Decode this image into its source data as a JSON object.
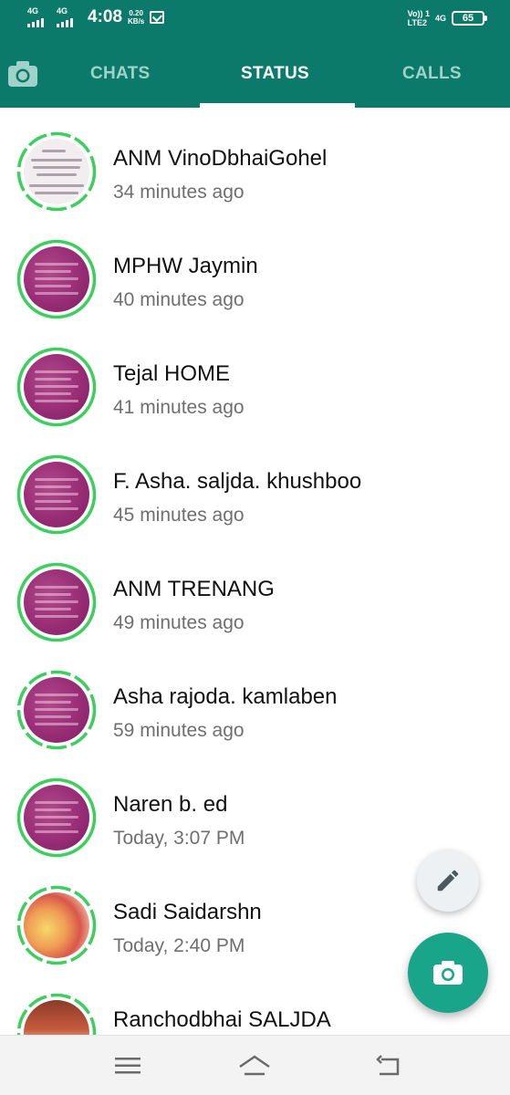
{
  "statusbar": {
    "sim1": "4G",
    "sim2": "4G",
    "time": "4:08",
    "speed_value": "0.20",
    "speed_unit": "KB/s",
    "volte_top": "Vo)) 1",
    "volte_bottom": "LTE2",
    "network": "4G",
    "battery": "65"
  },
  "tabs": {
    "chats": "CHATS",
    "status": "STATUS",
    "calls": "CALLS",
    "active": "STATUS"
  },
  "statuses": [
    {
      "name": "ANM VinoDbhaiGohel",
      "time": "34 minutes ago",
      "thumb": "document",
      "ring": "partial"
    },
    {
      "name": "MPHW Jaymin",
      "time": "40 minutes ago",
      "thumb": "purple",
      "ring": "full"
    },
    {
      "name": "Tejal HOME",
      "time": "41 minutes ago",
      "thumb": "purple",
      "ring": "full"
    },
    {
      "name": "F. Asha. saljda. khushboo",
      "time": "45 minutes ago",
      "thumb": "purple",
      "ring": "full"
    },
    {
      "name": "ANM TRENANG",
      "time": "49 minutes ago",
      "thumb": "purple",
      "ring": "full"
    },
    {
      "name": "Asha rajoda. kamlaben",
      "time": "59 minutes ago",
      "thumb": "purple",
      "ring": "partial"
    },
    {
      "name": "Naren b. ed",
      "time": "Today, 3:07 PM",
      "thumb": "purple",
      "ring": "full"
    },
    {
      "name": "Sadi Saidarshn",
      "time": "Today, 2:40 PM",
      "thumb": "photo",
      "ring": "partial"
    },
    {
      "name": "Ranchodbhai SALJDA",
      "time": "",
      "thumb": "temple",
      "ring": "partial"
    }
  ],
  "colors": {
    "header": "#0c7a6b",
    "ring_unseen": "#3ccf5e",
    "ring_seen": "#c7c7c7",
    "fab": "#19a589"
  },
  "icons": {
    "camera_tab": "camera-icon",
    "fab_edit": "pencil-icon",
    "fab_camera": "camera-icon",
    "nav_menu": "menu-icon",
    "nav_home": "home-icon",
    "nav_back": "back-icon"
  }
}
